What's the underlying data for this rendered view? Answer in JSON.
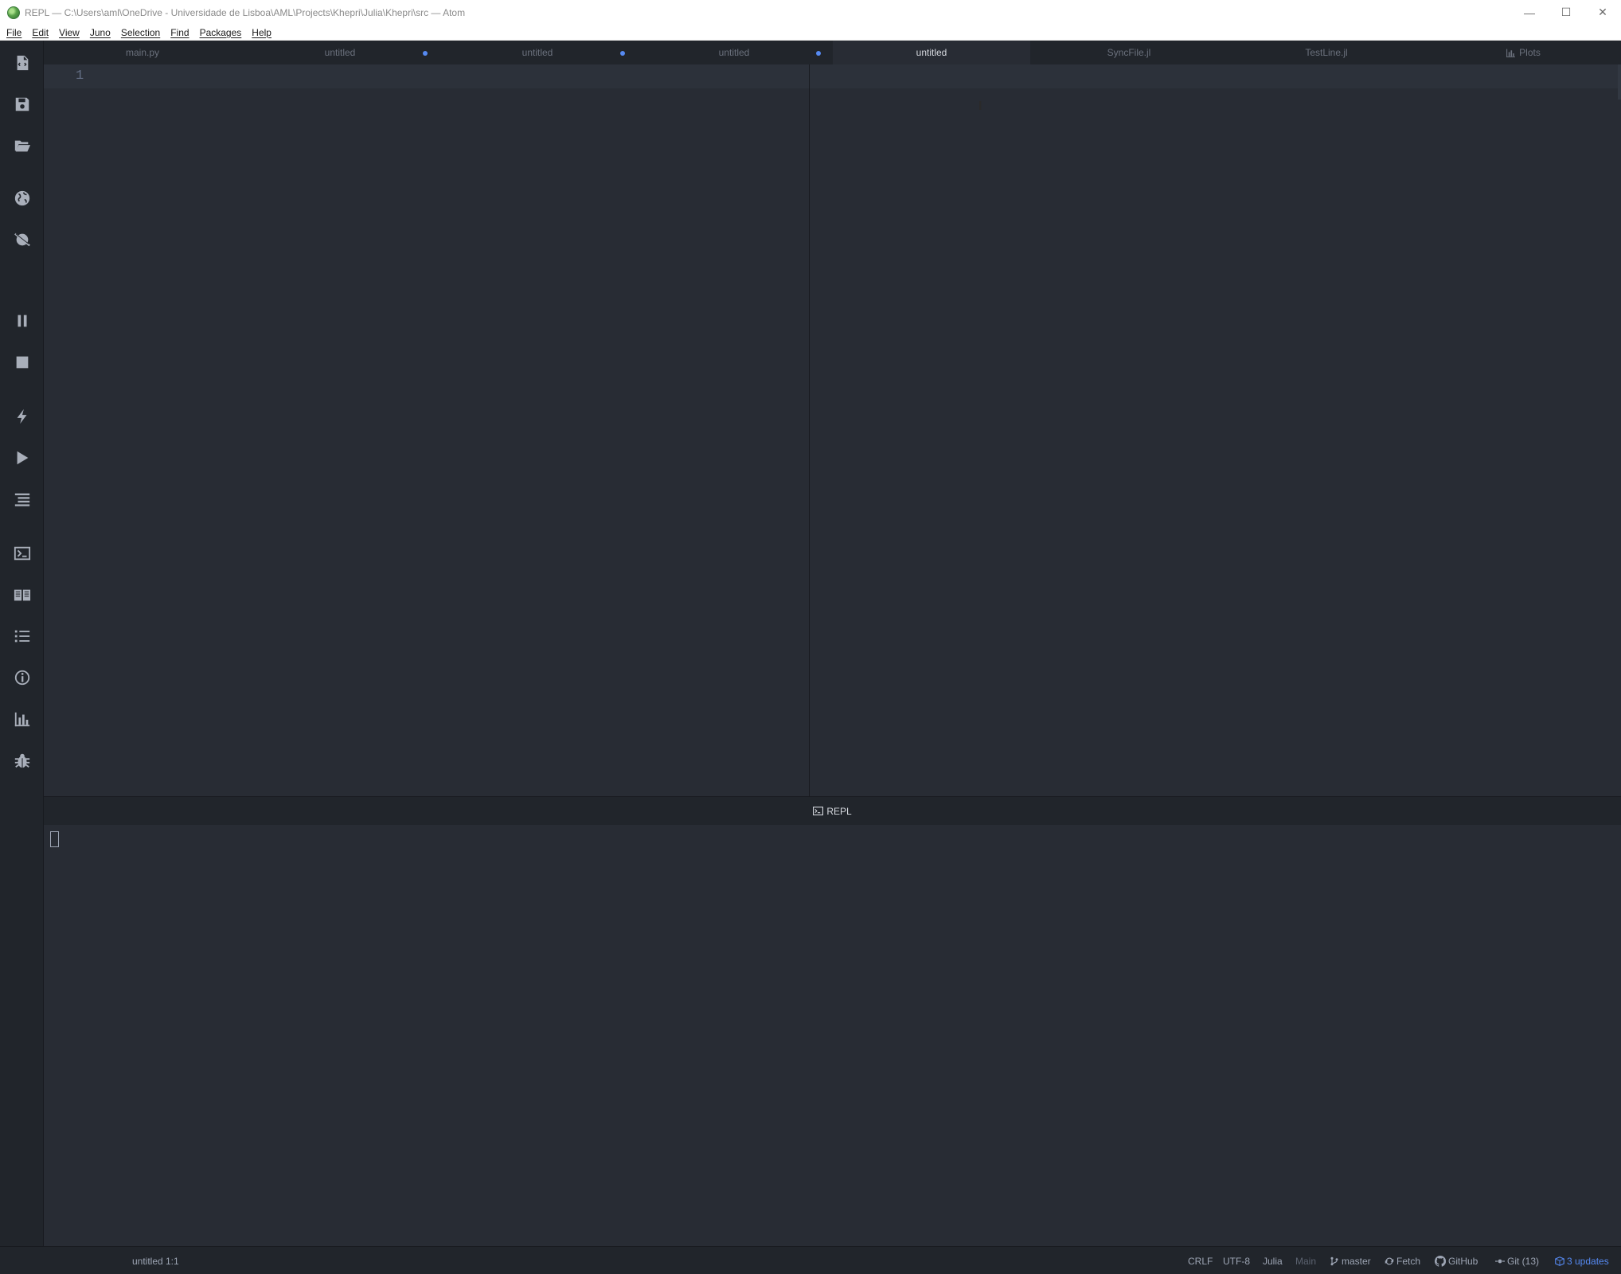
{
  "window": {
    "title": "REPL — C:\\Users\\aml\\OneDrive - Universidade de Lisboa\\AML\\Projects\\Khepri\\Julia\\Khepri\\src — Atom",
    "minimize_glyph": "—",
    "maximize_glyph": "☐",
    "close_glyph": "✕"
  },
  "menu": [
    "File",
    "Edit",
    "View",
    "Juno",
    "Selection",
    "Find",
    "Packages",
    "Help"
  ],
  "tabs": [
    {
      "label": "main.py",
      "modified": false,
      "active": false
    },
    {
      "label": "untitled",
      "modified": true,
      "active": false
    },
    {
      "label": "untitled",
      "modified": true,
      "active": false
    },
    {
      "label": "untitled",
      "modified": true,
      "active": false
    },
    {
      "label": "untitled",
      "modified": false,
      "active": true
    },
    {
      "label": "SyncFile.jl",
      "modified": false,
      "active": false
    },
    {
      "label": "TestLine.jl",
      "modified": false,
      "active": false
    },
    {
      "label": "Plots",
      "modified": false,
      "active": false,
      "icon": "bar-chart-icon"
    }
  ],
  "toolbar_icons": [
    "new-file-icon",
    "save-icon",
    "open-folder-icon",
    "globe-icon",
    "disconnect-icon",
    "pause-icon",
    "stop-icon",
    "lightning-icon",
    "play-icon",
    "format-icon",
    "terminal-icon",
    "book-icon",
    "list-icon",
    "info-icon",
    "bar-chart-icon",
    "bug-icon"
  ],
  "editor": {
    "line_numbers": [
      "1"
    ]
  },
  "repl": {
    "title": "REPL"
  },
  "status": {
    "file": "untitled",
    "position": "1:1",
    "line_ending": "CRLF",
    "encoding": "UTF-8",
    "grammar": "Julia",
    "module": "Main",
    "branch": "master",
    "fetch": "Fetch",
    "github": "GitHub",
    "git": "Git (13)",
    "updates": "3 updates"
  },
  "colors": {
    "accent": "#568af2",
    "editor_bg": "#282c34",
    "chrome_bg": "#21252b"
  }
}
